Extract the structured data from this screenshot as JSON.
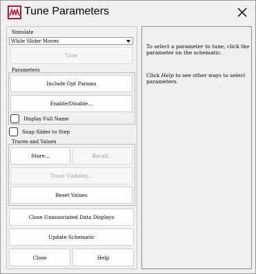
{
  "window": {
    "title": "Tune Parameters"
  },
  "simulate": {
    "label": "Simulate",
    "mode_selected": "While Slider Moves",
    "tune_button": "Tune"
  },
  "parameters": {
    "label": "Parameters",
    "include_opt_params": "Include Opt Params",
    "enable_disable": "Enable/Disable...",
    "display_full_name": "Display Full Name"
  },
  "snap_slider": "Snap Slider to Step",
  "traces": {
    "label": "Traces and Values",
    "store": "Store...",
    "recall": "Recall...",
    "trace_visibility": "Trace Visibility...",
    "reset_values": "Reset Values"
  },
  "bottom": {
    "close_unassociated": "Close Unassociated Data Displays",
    "update_schematic": "Update Schematic",
    "close": "Close",
    "help": "Help"
  },
  "help_panel": {
    "line1": "To select a parameter to tune, click the parameter on the schematic.",
    "line2_pre": "Click ",
    "line2_em": "Help",
    "line2_post": " to see other ways to select parameters."
  },
  "colors": {
    "icon_red": "#c8102e",
    "window_bg": "#f0f0f0"
  }
}
